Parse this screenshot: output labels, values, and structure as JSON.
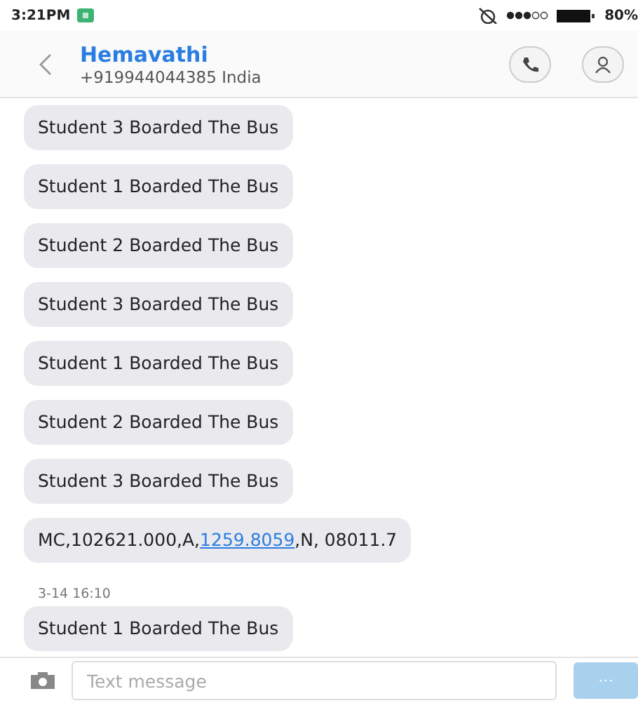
{
  "status_bar": {
    "time": "3:21PM",
    "battery": "80%"
  },
  "contact": {
    "name": "Hemavathi",
    "number": "+919944044385 India"
  },
  "messages": [
    {
      "kind": "message",
      "parts": [
        {
          "kind": "text",
          "text": "Student 3 Boarded The Bus"
        }
      ]
    },
    {
      "kind": "message",
      "parts": [
        {
          "kind": "text",
          "text": "Student 1 Boarded The Bus"
        }
      ]
    },
    {
      "kind": "message",
      "parts": [
        {
          "kind": "text",
          "text": "Student 2 Boarded The Bus"
        }
      ]
    },
    {
      "kind": "message",
      "parts": [
        {
          "kind": "text",
          "text": "Student 3 Boarded The Bus"
        }
      ]
    },
    {
      "kind": "message",
      "parts": [
        {
          "kind": "text",
          "text": "Student 1 Boarded The Bus"
        }
      ]
    },
    {
      "kind": "message",
      "parts": [
        {
          "kind": "text",
          "text": "Student 2 Boarded The Bus"
        }
      ]
    },
    {
      "kind": "message",
      "parts": [
        {
          "kind": "text",
          "text": "Student 3 Boarded The Bus"
        }
      ]
    },
    {
      "kind": "message",
      "parts": [
        {
          "kind": "text",
          "text": "MC,102621.000,A,"
        },
        {
          "kind": "link",
          "text": "1259.8059"
        },
        {
          "kind": "text",
          "text": ",N, 08011.7"
        }
      ]
    },
    {
      "kind": "timestamp",
      "text": "3-14 16:10"
    },
    {
      "kind": "message",
      "parts": [
        {
          "kind": "text",
          "text": "Student 1 Boarded The Bus"
        }
      ]
    }
  ],
  "composer": {
    "placeholder": "Text message",
    "send": "···"
  }
}
